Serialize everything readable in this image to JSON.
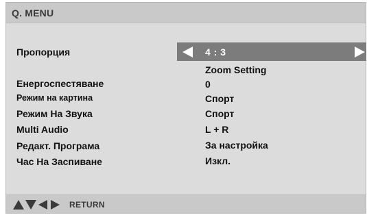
{
  "menu": {
    "title": "Q. MENU"
  },
  "rows": [
    {
      "label": "Пропорция",
      "value": "4 : 3",
      "selected": true
    },
    {
      "label": "",
      "value": "Zoom Setting"
    },
    {
      "label": "Енергоспестяване",
      "value": "0"
    },
    {
      "label": "Режим на картина",
      "value": "Спорт"
    },
    {
      "label": "Режим На Звука",
      "value": "Спорт"
    },
    {
      "label": "Multi Audio",
      "value": "L + R"
    },
    {
      "label": "Редакт. Програма",
      "value": "За настройка"
    },
    {
      "label": "Час На Заспиване",
      "value": "Изкл."
    }
  ],
  "footer": {
    "nav_icons": [
      "up-triangle-icon",
      "down-triangle-icon",
      "left-triangle-icon",
      "right-triangle-icon"
    ],
    "return_label": "RETURN"
  },
  "colors": {
    "panel_bg": "#dcdcdc",
    "bar_bg": "#c9c9c9",
    "highlight_bg": "#7c7c7c",
    "text": "#111111",
    "highlight_text": "#ffffff"
  }
}
